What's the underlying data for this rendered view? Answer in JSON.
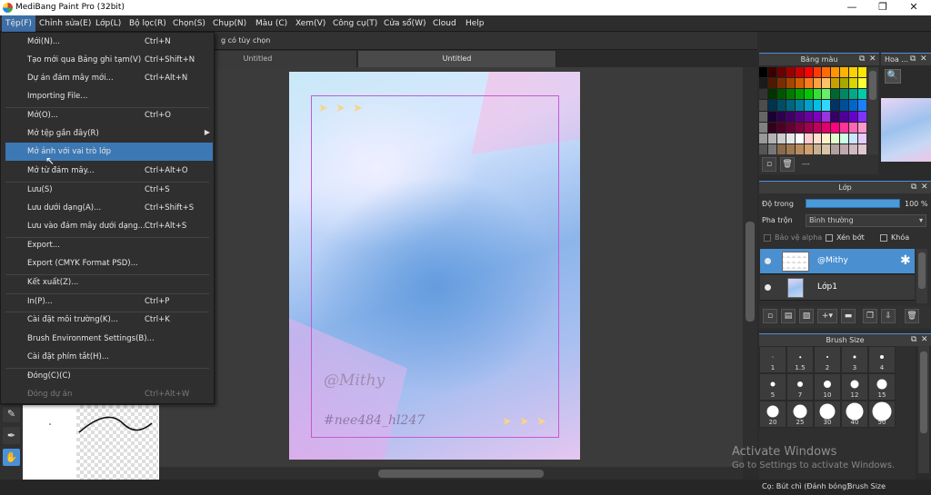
{
  "window": {
    "title": "MediBang Paint Pro (32bit)",
    "minimize": "—",
    "restore": "❐",
    "close": "✕"
  },
  "menubar": [
    "Tệp(F)",
    "Chỉnh sửa(E)",
    "Lớp(L)",
    "Bộ lọc(R)",
    "Chọn(S)",
    "Chụp(N)",
    "Màu (C)",
    "Xem(V)",
    "Công cụ(T)",
    "Cửa sổ(W)",
    "Cloud",
    "Help"
  ],
  "optionbar": {
    "text": "g có tùy chọn"
  },
  "tabs": [
    "Untitled",
    "Untitled"
  ],
  "file_menu": [
    {
      "label": "Mới(N)...",
      "shortcut": "Ctrl+N"
    },
    {
      "label": "Tạo mới qua Bảng ghi tạm(V)",
      "shortcut": "Ctrl+Shift+N"
    },
    {
      "label": "Dự án đám mây mới...",
      "shortcut": "Ctrl+Alt+N"
    },
    {
      "label": "Importing File...",
      "shortcut": ""
    },
    {
      "label": "Mở(O)...",
      "shortcut": "Ctrl+O"
    },
    {
      "label": "Mở tệp gần đây(R)",
      "shortcut": ""
    },
    {
      "label": "Mở ảnh với vai trò lớp",
      "shortcut": ""
    },
    {
      "label": "Mở từ đám mây...",
      "shortcut": "Ctrl+Alt+O"
    },
    {
      "label": "Lưu(S)",
      "shortcut": "Ctrl+S"
    },
    {
      "label": "Lưu dưới dạng(A)...",
      "shortcut": "Ctrl+Shift+S"
    },
    {
      "label": "Lưu vào đám mây dưới dạng...",
      "shortcut": "Ctrl+Alt+S"
    },
    {
      "label": "Export...",
      "shortcut": ""
    },
    {
      "label": "Export (CMYK Format PSD)...",
      "shortcut": ""
    },
    {
      "label": "Kết xuất(Z)...",
      "shortcut": ""
    },
    {
      "label": "In(P)...",
      "shortcut": "Ctrl+P"
    },
    {
      "label": "Cài đặt môi trường(K)...",
      "shortcut": "Ctrl+K"
    },
    {
      "label": "Brush Environment Settings(B)...",
      "shortcut": ""
    },
    {
      "label": "Cài đặt phím tắt(H)...",
      "shortcut": ""
    },
    {
      "label": "Đóng(C)(C)",
      "shortcut": ""
    },
    {
      "label": "Đóng dự án",
      "shortcut": "Ctrl+Alt+W"
    }
  ],
  "artwork": {
    "signature": "@Mithy",
    "hashtag": "#nee484_hl247",
    "arrows": "➤ ➤ ➤"
  },
  "panels": {
    "color_palette": {
      "title": "Bảng màu",
      "dash": "---"
    },
    "navigator": {
      "title": "Hoa ..."
    },
    "layers": {
      "title": "Lớp",
      "opacity_label": "Độ trong",
      "opacity_value": "100 %",
      "blend_label": "Pha trộn",
      "blend_value": "Bình thường",
      "protect_alpha": "Bảo vệ alpha",
      "clipping": "Xén bớt",
      "lock": "Khóa",
      "items": [
        {
          "name": "@Mithy"
        },
        {
          "name": "Lớp1"
        }
      ]
    },
    "brush_size": {
      "title": "Brush Size",
      "sizes": [
        "1",
        "1.5",
        "2",
        "3",
        "4",
        "5",
        "7",
        "10",
        "12",
        "15",
        "20",
        "25",
        "30",
        "40",
        "50"
      ]
    }
  },
  "statusbar": {
    "tool": "Cọ: Bút chì (Đánh bóng)",
    "panel": "Brush Size"
  },
  "watermark": {
    "line1": "Activate Windows",
    "line2": "Go to Settings to activate Windows."
  },
  "colors": {
    "accent": "#4a90d9",
    "menu_highlight": "#3c78b4",
    "frame": "#c55ad0"
  }
}
